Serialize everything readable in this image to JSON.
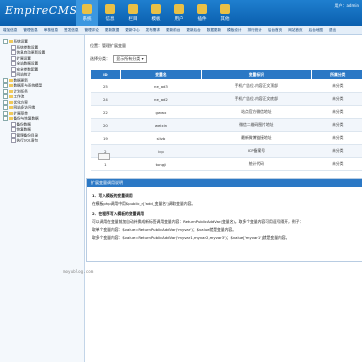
{
  "app": {
    "logo_text": "EmpireCMS",
    "user_info": "用户：admin"
  },
  "top_tabs": [
    "系统",
    "信息",
    "栏目",
    "模板",
    "用户",
    "插件",
    "其他"
  ],
  "sub_nav": [
    "增加信息",
    "管理信息",
    "审核信息",
    "签发信息",
    "管理评论",
    "更新数据",
    "更新中心",
    "发布需求",
    "更新前台",
    "更新后台",
    "数据更新",
    "模板设计",
    "排行统计",
    "后台首页",
    "网站首页",
    "后台地图",
    "退出"
  ],
  "sidebar": {
    "items": [
      {
        "label": "系统设置",
        "type": "folder",
        "indent": 0
      },
      {
        "label": "系统参数设置",
        "type": "doc",
        "indent": 2
      },
      {
        "label": "信息自动更新设置",
        "type": "doc",
        "indent": 2
      },
      {
        "label": "扩展设置",
        "type": "doc",
        "indent": 2
      },
      {
        "label": "全站数据设置",
        "type": "doc",
        "indent": 2
      },
      {
        "label": "安全参数配置",
        "type": "doc",
        "indent": 2
      },
      {
        "label": "网站统计",
        "type": "doc",
        "indent": 2
      },
      {
        "label": "数据更新",
        "type": "folder",
        "indent": 0
      },
      {
        "label": "数据库与系统模型",
        "type": "folder",
        "indent": 0
      },
      {
        "label": "计划任务",
        "type": "folder",
        "indent": 0
      },
      {
        "label": "工作流",
        "type": "folder",
        "indent": 0
      },
      {
        "label": "优化方案",
        "type": "folder",
        "indent": 0
      },
      {
        "label": "网站多访问端",
        "type": "folder",
        "indent": 0
      },
      {
        "label": "扩展菜单",
        "type": "folder",
        "indent": 0
      },
      {
        "label": "备份与恢复数据",
        "type": "folder",
        "indent": 0
      },
      {
        "label": "备份数据",
        "type": "doc",
        "indent": 2
      },
      {
        "label": "恢复数据",
        "type": "doc",
        "indent": 2
      },
      {
        "label": "管理备份目录",
        "type": "doc",
        "indent": 2
      },
      {
        "label": "执行SQL语句",
        "type": "doc",
        "indent": 2
      }
    ]
  },
  "main": {
    "breadcrumb": "位置：管理扩展变量",
    "selector_label": "选择分类：",
    "selector_value": "显示所有分类",
    "table": {
      "headers": [
        "ID",
        "变量名",
        "变量标识",
        "所属分类"
      ],
      "rows": [
        [
          "25",
          "ne_ad3",
          "手机广告位-内容正文顶部",
          "未分类"
        ],
        [
          "24",
          "ne_ad2",
          "手机广告位-内容正文底部",
          "未分类"
        ],
        [
          "22",
          "gwwx",
          "站点官方微信地址",
          "未分类"
        ],
        [
          "20",
          "weixin",
          "微信二维码图片地址",
          "未分类"
        ],
        [
          "19",
          "slivb",
          "最新微博链接地址",
          "未分类"
        ],
        [
          "2",
          "icp",
          "ICP备案号",
          "未分类"
        ],
        [
          "1",
          "tongji",
          "统计代码",
          "未分类"
        ]
      ]
    }
  },
  "note": {
    "title": "扩展变量调用说明",
    "h1": "1．写入模板的变量调用",
    "p1": "在模板php调用中用$public_r['add_变量名']调取变量内容。",
    "h2": "2．在程序写入模板的变量调用",
    "p2": "可以调用在变量前加自动补换成新标签调用变量内容：ReturnPublicAddVar(变量名)。取多个变量内容可用逗号隔开，例子：",
    "p3": "取单个变量内容：$value=ReturnPublicAddVar('myvar')；$value就是变量内容。",
    "p4": "取多个变量内容：$value=ReturnPublicAddVar('myvar1,myvar2,myvar3')；$value['myvar1']就是变量内容。"
  },
  "watermark": "moyublog.com",
  "colors": {
    "header_blue": "#0a5fae",
    "table_head": "#2b78c5"
  }
}
